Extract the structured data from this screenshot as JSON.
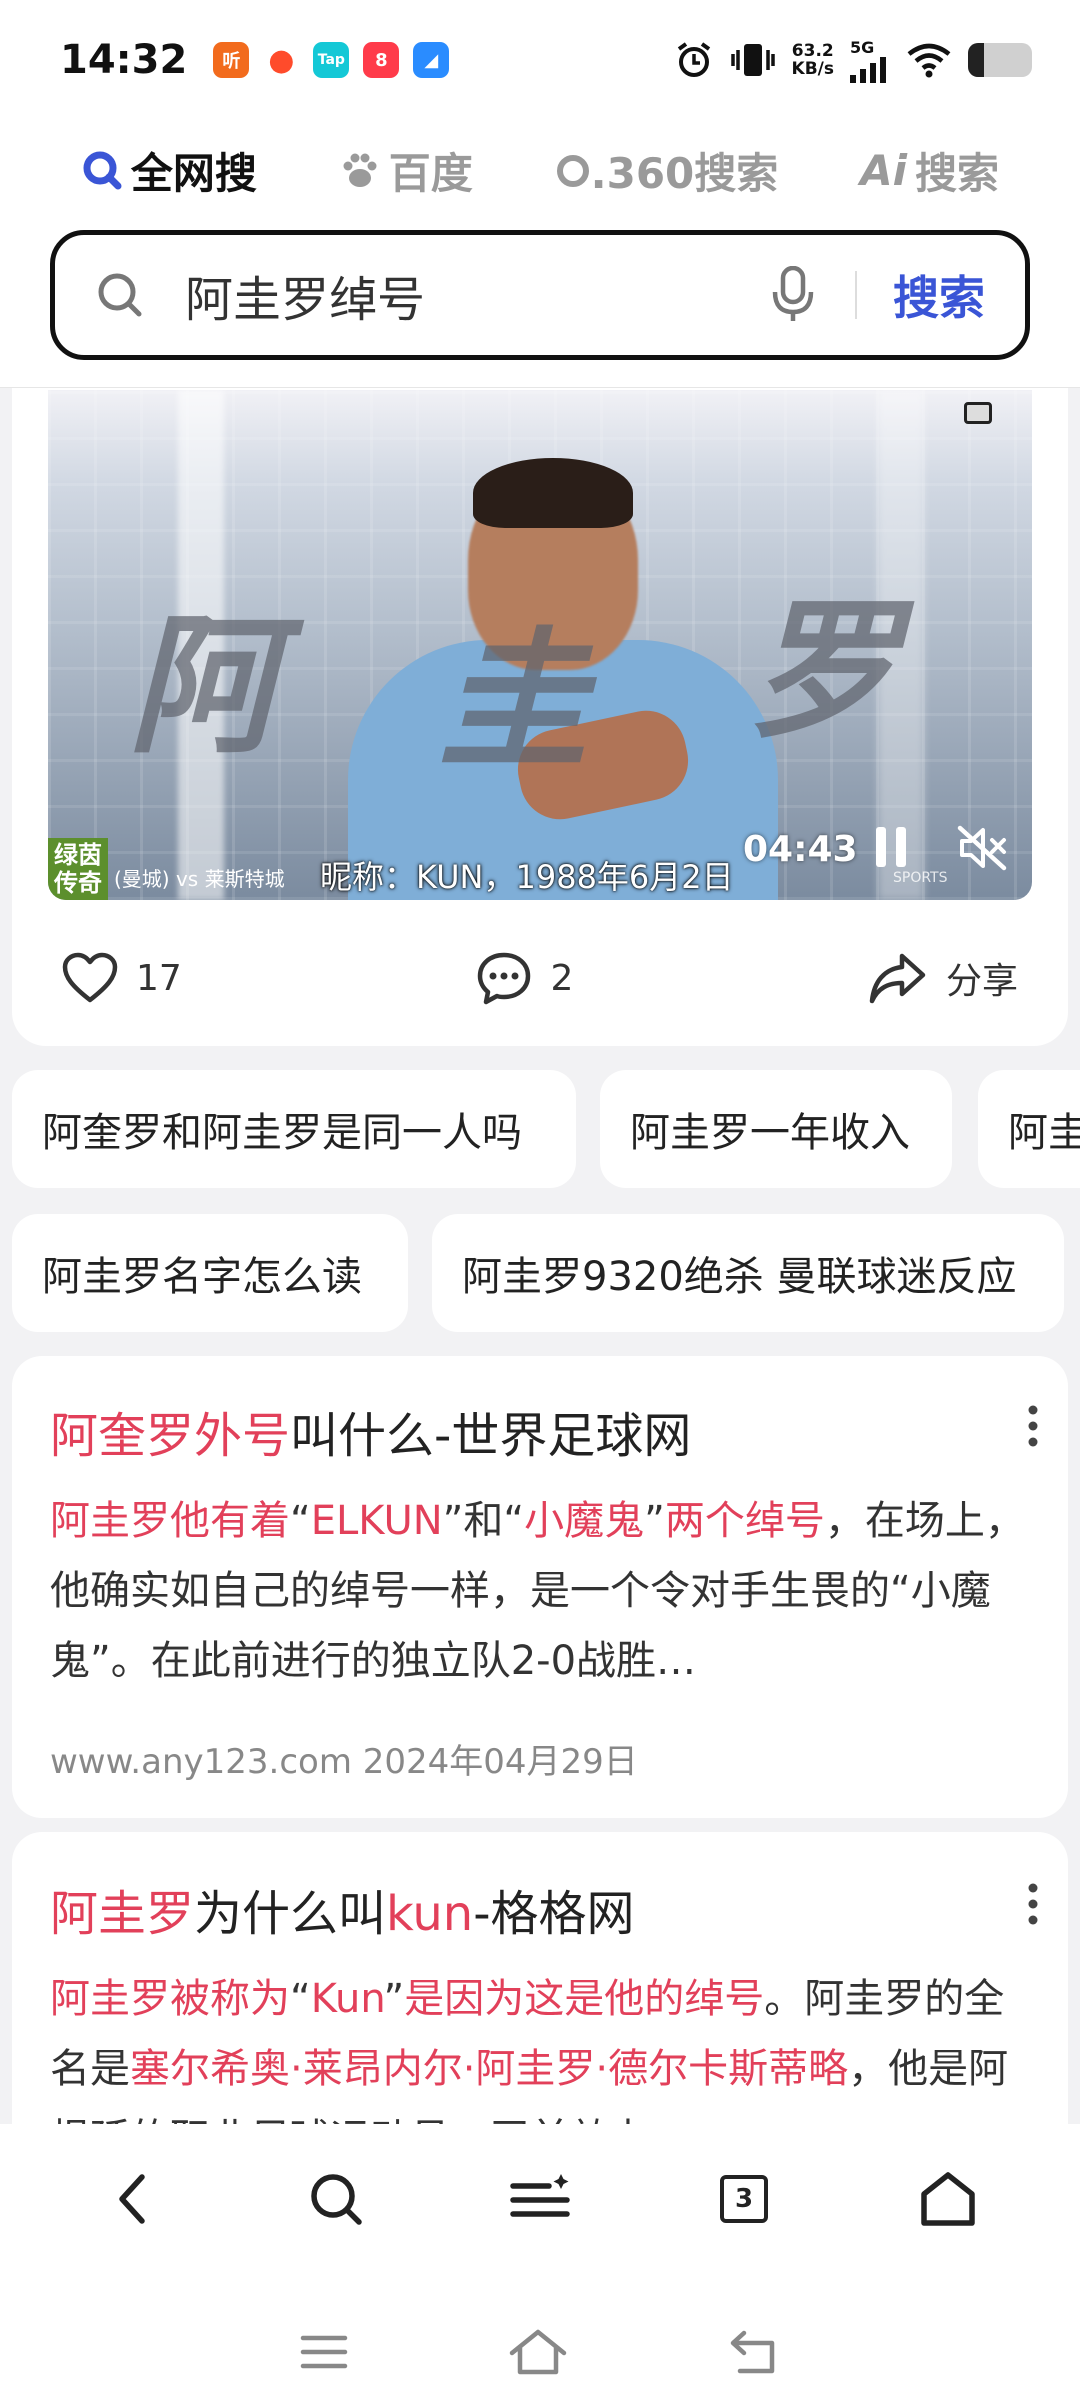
{
  "status_bar": {
    "time": "14:32",
    "notification_icons": [
      {
        "name": "ting-app-icon",
        "glyph": "听",
        "color": "#f26b1d"
      },
      {
        "name": "weibo-app-icon",
        "glyph": "●",
        "color": "#ff4b2b"
      },
      {
        "name": "taptap-app-icon",
        "glyph": "Tap",
        "color": "#14c8d6"
      },
      {
        "name": "xiaohongshu-app-icon",
        "glyph": "8",
        "color": "#ff3b4a"
      },
      {
        "name": "cloud-app-icon",
        "glyph": "◢",
        "color": "#2a8cff"
      }
    ],
    "net_speed_value": "63.2",
    "net_speed_unit": "KB/s",
    "network_type": "5G",
    "battery_level": 0.25
  },
  "engines": {
    "tabs": [
      {
        "label": "全网搜",
        "icon": "search-q-icon",
        "active": true
      },
      {
        "label": "百度",
        "icon": "baidu-paw-icon",
        "active": false
      },
      {
        "label": ".360搜索",
        "icon": "ring-icon",
        "active": false
      },
      {
        "label": "搜索",
        "icon": "ai-icon",
        "icon_text": "Ai",
        "active": false
      }
    ]
  },
  "search": {
    "query": "阿圭罗绰号",
    "button_label": "搜索",
    "accent_color": "#3a55d6"
  },
  "video": {
    "calligraphy": [
      "阿",
      "圭",
      "罗"
    ],
    "channel_logo": [
      "绿茵",
      "传奇"
    ],
    "match_label": "(曼城) vs 莱斯特城",
    "subtitle": "昵称：KUN，1988年6月2日",
    "duration": "04:43",
    "watermark": "SPORTS",
    "likes": "17",
    "comments": "2",
    "share_label": "分享"
  },
  "related": {
    "chips": [
      "阿奎罗和阿圭罗是同一人吗",
      "阿圭罗一年收入",
      "阿圭",
      "阿圭罗名字怎么读",
      "阿圭罗9320绝杀 曼联球迷反应"
    ]
  },
  "results": [
    {
      "title_hl": "阿奎罗外号",
      "title_rest": "叫什么-世界足球网",
      "snippet": [
        {
          "t": "阿圭罗他有着",
          "hl": true
        },
        {
          "t": "“",
          "hl": false
        },
        {
          "t": "ELKUN",
          "hl": true
        },
        {
          "t": "”和“",
          "hl": false
        },
        {
          "t": "小魔鬼",
          "hl": true
        },
        {
          "t": "”",
          "hl": false
        },
        {
          "t": "两个绰号",
          "hl": true
        },
        {
          "t": "，在场上，他确实如自己的绰号一样，是一个令对手生畏的“小魔鬼”。在此前进行的独立队2-0战胜…",
          "hl": false
        }
      ],
      "source": "www.any123.com",
      "date": "2024年04月29日"
    },
    {
      "title_hl": "阿圭罗",
      "title_mid": "为什么叫",
      "title_hl2": "kun",
      "title_rest": "-格格网",
      "snippet": [
        {
          "t": "阿圭罗被称为",
          "hl": true
        },
        {
          "t": "“",
          "hl": false
        },
        {
          "t": "Kun",
          "hl": true
        },
        {
          "t": "”",
          "hl": false
        },
        {
          "t": "是因为这是他的绰号",
          "hl": true
        },
        {
          "t": "。阿圭罗的全名是",
          "hl": false
        },
        {
          "t": "塞尔希奥·莱昂内尔·阿圭罗·德尔卡斯蒂略",
          "hl": true
        },
        {
          "t": "，他是阿根廷的职业足球运动员，司前效力…",
          "hl": false
        }
      ]
    }
  ],
  "bottom_nav": {
    "tab_count": "3"
  },
  "colors": {
    "highlight": "#e2405a",
    "page_bg": "#f2f2f4"
  }
}
